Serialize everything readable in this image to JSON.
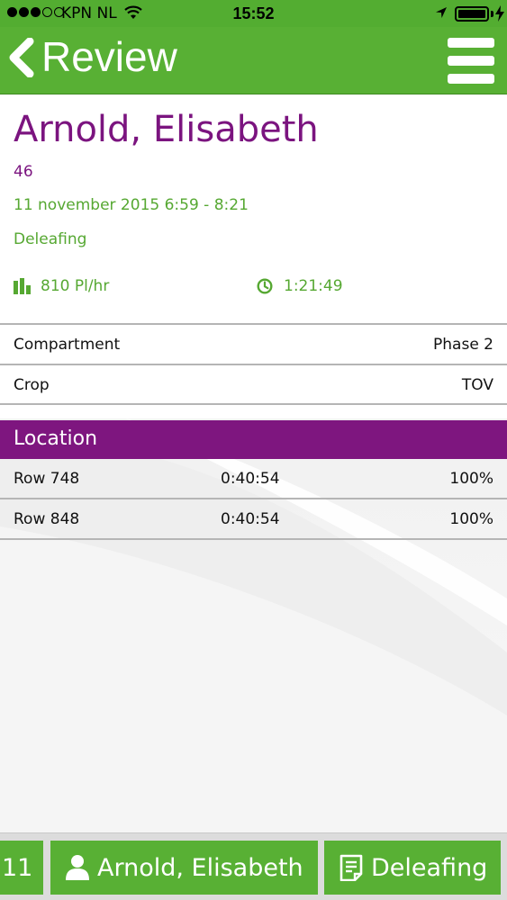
{
  "status_bar": {
    "carrier": "KPN NL",
    "time": "15:52",
    "signal_bars": 3,
    "battery_level": 1.0
  },
  "header": {
    "title": "Review",
    "back_icon": "chevron-left-icon",
    "menu_icon": "hamburger-menu-icon"
  },
  "record": {
    "name": "Arnold, Elisabeth",
    "number": "46",
    "datetime": "11 november 2015 6:59 - 8:21",
    "activity": "Deleafing",
    "rate": "810 Pl/hr",
    "duration": "1:21:49"
  },
  "details": [
    {
      "label": "Compartment",
      "value": "Phase 2"
    },
    {
      "label": "Crop",
      "value": "TOV"
    }
  ],
  "location": {
    "title": "Location",
    "rows": [
      {
        "name": "Row 748",
        "time": "0:40:54",
        "percent": "100%"
      },
      {
        "name": "Row 848",
        "time": "0:40:54",
        "percent": "100%"
      }
    ]
  },
  "bottom_bar": {
    "date_label": "11",
    "person_label": "Arnold, Elisabeth",
    "activity_label": "Deleafing"
  },
  "colors": {
    "brand_green": "#58b034",
    "brand_purple": "#7e167f",
    "text_green": "#56a832"
  }
}
